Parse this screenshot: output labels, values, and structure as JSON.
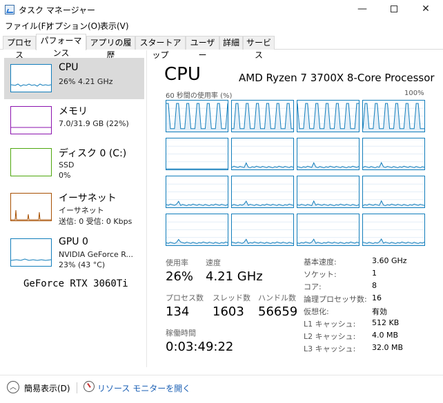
{
  "window": {
    "title": "タスク マネージャー",
    "minimize": "—",
    "close": "✕"
  },
  "menu": [
    "ファイル(F)",
    "オプション(O)",
    "表示(V)"
  ],
  "tabs": [
    "プロセス",
    "パフォーマンス",
    "アプリの履歴",
    "スタートアップ",
    "ユーザー",
    "詳細",
    "サービス"
  ],
  "active_tab": 1,
  "sidebar": {
    "items": [
      {
        "name": "CPU",
        "line1": "26%  4.21 GHz",
        "line2": "",
        "color": "#117dbb"
      },
      {
        "name": "メモリ",
        "line1": "7.0/31.9 GB (22%)",
        "line2": "",
        "color": "#8b12ae"
      },
      {
        "name": "ディスク 0 (C:)",
        "line1": "SSD",
        "line2": "0%",
        "color": "#4da60c"
      },
      {
        "name": "イーサネット",
        "line1": "イーサネット",
        "line2": "送信: 0  受信: 0 Kbps",
        "color": "#a74f01"
      },
      {
        "name": "GPU 0",
        "line1": "NVIDIA GeForce R...",
        "line2": "23% (43 °C)",
        "color": "#117dbb"
      }
    ],
    "gpu_caption": "GeForce RTX 3060Ti"
  },
  "main": {
    "title": "CPU",
    "model": "AMD Ryzen 7 3700X 8-Core Processor",
    "graph_left_label": "60 秒間の使用率 (%)",
    "graph_right_label": "100%",
    "stats": {
      "utilization_label": "使用率",
      "utilization": "26%",
      "speed_label": "速度",
      "speed": "4.21 GHz",
      "processes_label": "プロセス数",
      "processes": "134",
      "threads_label": "スレッド数",
      "threads": "1603",
      "handles_label": "ハンドル数",
      "handles": "56659",
      "uptime_label": "稼働時間",
      "uptime": "0:03:49:22"
    },
    "details": [
      {
        "key": "基本速度:",
        "value": "3.60 GHz"
      },
      {
        "key": "ソケット:",
        "value": "1"
      },
      {
        "key": "コア:",
        "value": "8"
      },
      {
        "key": "論理プロセッサ数:",
        "value": "16"
      },
      {
        "key": "仮想化:",
        "value": "有効"
      },
      {
        "key": "L1 キャッシュ:",
        "value": "512 KB"
      },
      {
        "key": "L2 キャッシュ:",
        "value": "4.0 MB"
      },
      {
        "key": "L3 キャッシュ:",
        "value": "32.0 MB"
      }
    ]
  },
  "footer": {
    "fewer_details": "簡易表示(D)",
    "resource_monitor": "リソース モニターを開く"
  },
  "colors": {
    "cpu": "#117dbb",
    "selected_bg": "#dadada",
    "link": "#1a5fb4"
  }
}
